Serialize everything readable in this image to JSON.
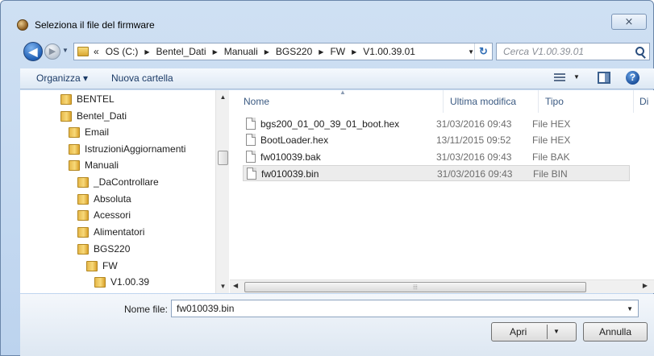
{
  "window": {
    "title": "Seleziona il file del firmware",
    "close_symbol": "⨯"
  },
  "nav": {
    "back_symbol": "◀",
    "forward_symbol": "▶",
    "breadcrumb": [
      "«",
      "OS (C:)",
      "Bentel_Dati",
      "Manuali",
      "BGS220",
      "FW",
      "V1.00.39.01"
    ],
    "breadcrumb_sep": "▶",
    "refresh_symbol": "↻"
  },
  "search": {
    "placeholder": "Cerca V1.00.39.01"
  },
  "toolbar": {
    "organize_label": "Organizza ▾",
    "new_folder_label": "Nuova cartella",
    "help_symbol": "?"
  },
  "tree": [
    {
      "label": "BENTEL",
      "level": 0
    },
    {
      "label": "Bentel_Dati",
      "level": 0
    },
    {
      "label": "Email",
      "level": 1
    },
    {
      "label": "IstruzioniAggiornamenti",
      "level": 1
    },
    {
      "label": "Manuali",
      "level": 1
    },
    {
      "label": "_DaControllare",
      "level": 2
    },
    {
      "label": "Absoluta",
      "level": 2
    },
    {
      "label": "Acessori",
      "level": 2
    },
    {
      "label": "Alimentatori",
      "level": 2
    },
    {
      "label": "BGS220",
      "level": 2
    },
    {
      "label": "FW",
      "level": 3
    },
    {
      "label": "V1.00.39",
      "level": 4
    }
  ],
  "columns": [
    "Nome",
    "Ultima modifica",
    "Tipo",
    "Di"
  ],
  "files": [
    {
      "name": "bgs200_01_00_39_01_boot.hex",
      "modified": "31/03/2016 09:43",
      "type": "File HEX",
      "selected": false
    },
    {
      "name": "BootLoader.hex",
      "modified": "13/11/2015 09:52",
      "type": "File HEX",
      "selected": false
    },
    {
      "name": "fw010039.bak",
      "modified": "31/03/2016 09:43",
      "type": "File BAK",
      "selected": false
    },
    {
      "name": "fw010039.bin",
      "modified": "31/03/2016 09:43",
      "type": "File BIN",
      "selected": true
    }
  ],
  "bottom": {
    "filename_label": "Nome file:",
    "filename_value": "fw010039.bin",
    "open_label": "Apri",
    "cancel_label": "Annulla"
  }
}
